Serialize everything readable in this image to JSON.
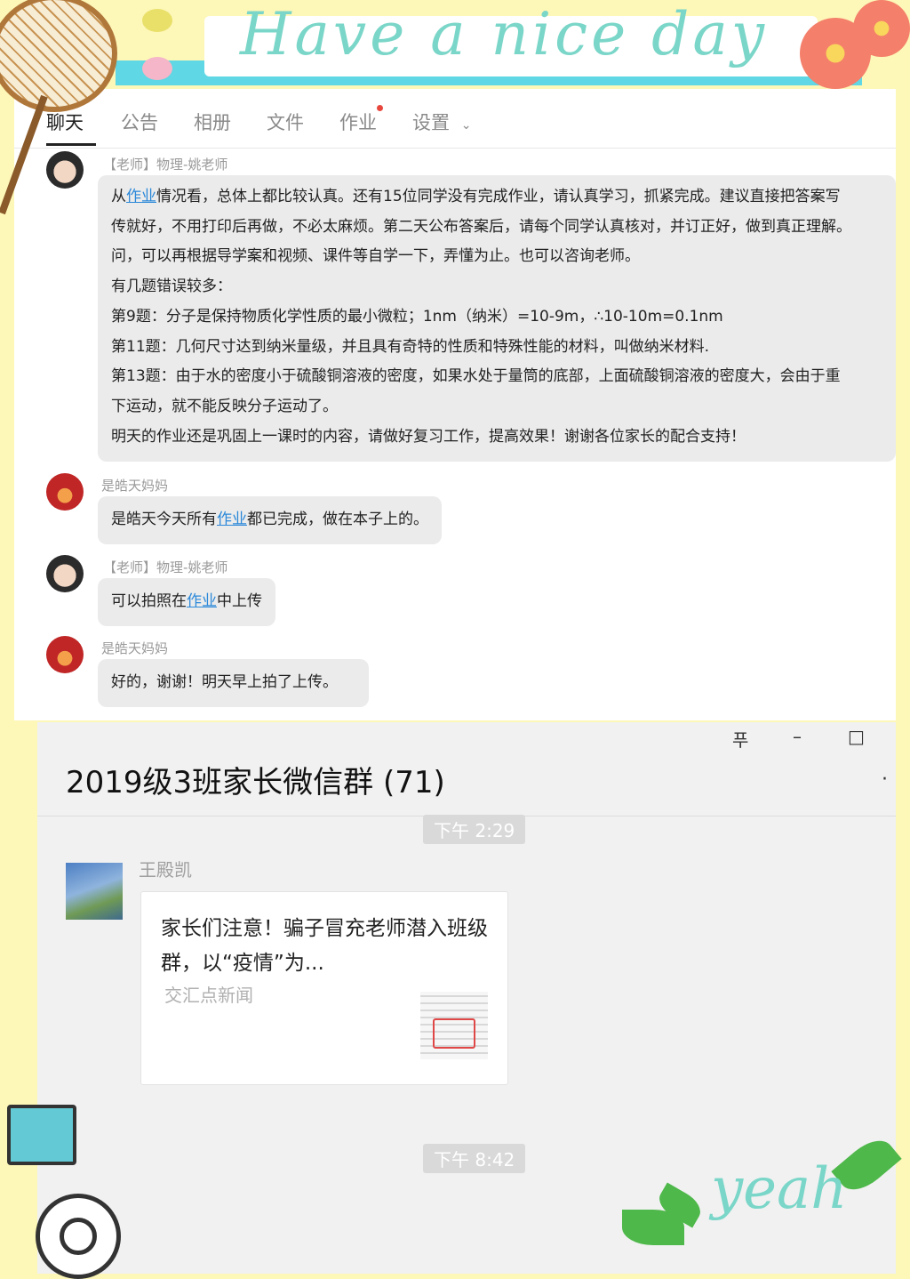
{
  "banner": {
    "slogan": "Have a nice day",
    "yeah": "yeah"
  },
  "qq": {
    "tabs": [
      {
        "label": "聊天",
        "active": true,
        "dot": false
      },
      {
        "label": "公告",
        "active": false,
        "dot": false
      },
      {
        "label": "相册",
        "active": false,
        "dot": false
      },
      {
        "label": "文件",
        "active": false,
        "dot": false
      },
      {
        "label": "作业",
        "active": false,
        "dot": true
      },
      {
        "label": "设置",
        "active": false,
        "dot": false
      }
    ],
    "settings_chevron": "chevron-down-icon",
    "messages": [
      {
        "sender": "【老师】物理-姚老师",
        "avatar": "teacher-avatar",
        "lines": [
          {
            "pre": "从",
            "link": "作业",
            "post": "情况看，总体上都比较认真。还有15位同学没有完成作业，请认真学习，抓紧完成。建议直接把答案写"
          },
          {
            "pre": "传就好，不用打印后再做，不必太麻烦。第二天公布答案后，请每个同学认真核对，并订正好，做到真正理解。",
            "link": "",
            "post": ""
          },
          {
            "pre": "问，可以再根据导学案和视频、课件等自学一下，弄懂为止。也可以咨询老师。",
            "link": "",
            "post": ""
          },
          {
            "pre": "有几题错误较多：",
            "link": "",
            "post": ""
          },
          {
            "pre": "第9题：分子是保持物质化学性质的最小微粒；1nm（纳米）=10-9m，∴10-10m=0.1nm",
            "link": "",
            "post": ""
          },
          {
            "pre": "第11题：几何尺寸达到纳米量级，并且具有奇特的性质和特殊性能的材料，叫做纳米材料.",
            "link": "",
            "post": ""
          },
          {
            "pre": "第13题：由于水的密度小于硫酸铜溶液的密度，如果水处于量筒的底部，上面硫酸铜溶液的密度大，会由于重",
            "link": "",
            "post": ""
          },
          {
            "pre": "下运动，就不能反映分子运动了。",
            "link": "",
            "post": ""
          },
          {
            "pre": "明天的作业还是巩固上一课时的内容，请做好复习工作，提高效果！谢谢各位家长的配合支持！",
            "link": "",
            "post": ""
          }
        ]
      },
      {
        "sender": "是皓天妈妈",
        "avatar": "parent-avatar",
        "lines": [
          {
            "pre": "是皓天今天所有",
            "link": "作业",
            "post": "都已完成，做在本子上的。"
          }
        ]
      },
      {
        "sender": "【老师】物理-姚老师",
        "avatar": "teacher-avatar",
        "lines": [
          {
            "pre": "可以拍照在",
            "link": "作业",
            "post": "中上传"
          }
        ]
      },
      {
        "sender": "是皓天妈妈",
        "avatar": "parent-avatar",
        "lines": [
          {
            "pre": "好的，谢谢！明天早上拍了上传。",
            "link": "",
            "post": ""
          }
        ]
      }
    ]
  },
  "wechat": {
    "title": "2019级3班家长微信群 (71)",
    "controls": {
      "pin": "푸",
      "minimize": "–",
      "maximize": "□",
      "more": "·"
    },
    "time1": "下午 2:29",
    "sender": "王殿凯",
    "card": {
      "title": "家长们注意！骗子冒充老师潜入班级群，以“疫情”为...",
      "source": "交汇点新闻"
    },
    "time2": "下午 8:42"
  }
}
